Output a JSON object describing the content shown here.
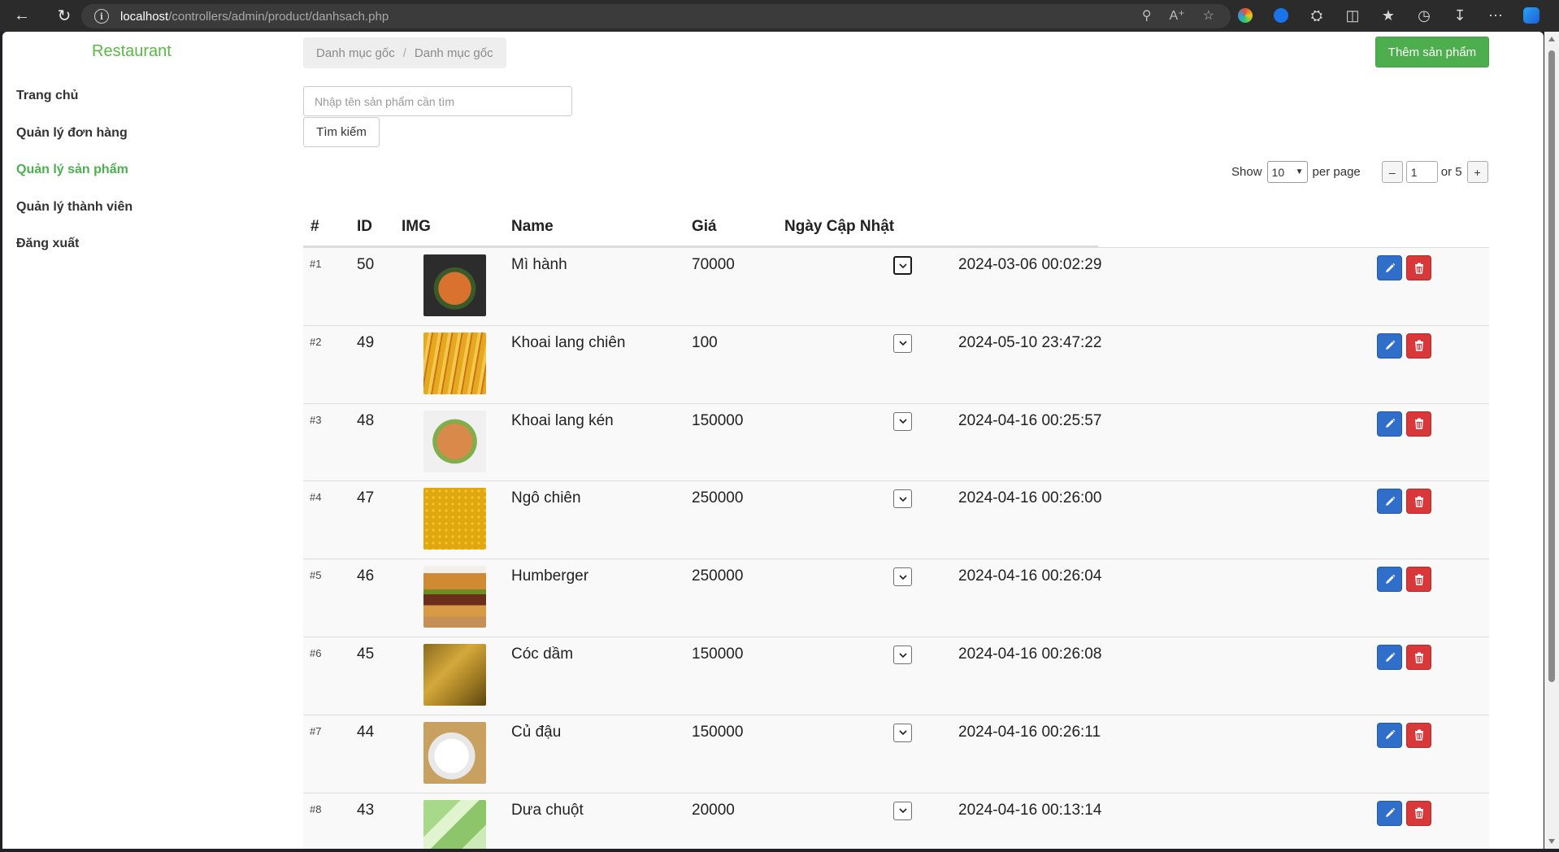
{
  "browser": {
    "url_host": "localhost",
    "url_path": "/controllers/admin/product/danhsach.php"
  },
  "sidebar": {
    "brand": "Restaurant",
    "items": [
      {
        "label": "Trang chủ",
        "active": false
      },
      {
        "label": "Quản lý đơn hàng",
        "active": false
      },
      {
        "label": "Quản lý sản phẩm",
        "active": true
      },
      {
        "label": "Quản lý thành viên",
        "active": false
      },
      {
        "label": "Đăng xuất",
        "active": false
      }
    ]
  },
  "breadcrumb": [
    "Danh mục gốc",
    "Danh mục gốc"
  ],
  "add_button": "Thêm sản phẩm",
  "search": {
    "placeholder": "Nhập tên sản phẩm cần tìm",
    "button": "Tìm kiếm"
  },
  "pager": {
    "show": "Show",
    "per_page_value": "10",
    "per_page": "per page",
    "minus": "–",
    "current_page": "1",
    "of": "or 5",
    "plus": "+"
  },
  "table": {
    "headers": [
      "#",
      "ID",
      "IMG",
      "Name",
      "Giá",
      "Ngày Cập Nhật"
    ],
    "rows": [
      {
        "idx": "#1",
        "id": "50",
        "name": "Mì hành",
        "price": "70000",
        "updated": "2024-03-06 00:02:29"
      },
      {
        "idx": "#2",
        "id": "49",
        "name": "Khoai lang chiên",
        "price": "100",
        "updated": "2024-05-10 23:47:22"
      },
      {
        "idx": "#3",
        "id": "48",
        "name": "Khoai lang kén",
        "price": "150000",
        "updated": "2024-04-16 00:25:57"
      },
      {
        "idx": "#4",
        "id": "47",
        "name": "Ngô chiên",
        "price": "250000",
        "updated": "2024-04-16 00:26:00"
      },
      {
        "idx": "#5",
        "id": "46",
        "name": "Humberger",
        "price": "250000",
        "updated": "2024-04-16 00:26:04"
      },
      {
        "idx": "#6",
        "id": "45",
        "name": "Cóc dầm",
        "price": "150000",
        "updated": "2024-04-16 00:26:08"
      },
      {
        "idx": "#7",
        "id": "44",
        "name": "Củ đậu",
        "price": "150000",
        "updated": "2024-04-16 00:26:11"
      },
      {
        "idx": "#8",
        "id": "43",
        "name": "Dưa chuột",
        "price": "20000",
        "updated": "2024-04-16 00:13:14"
      }
    ]
  },
  "colors": {
    "brand_green": "#5bb845",
    "add_green": "#4cae4c",
    "edit_blue": "#2f6fc9",
    "delete_red": "#d9383a"
  }
}
